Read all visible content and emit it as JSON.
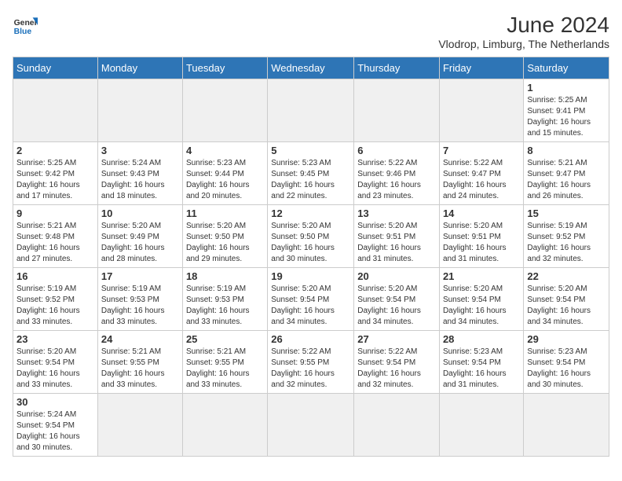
{
  "header": {
    "logo_text_general": "General",
    "logo_text_blue": "Blue",
    "title": "June 2024",
    "subtitle": "Vlodrop, Limburg, The Netherlands"
  },
  "weekdays": [
    "Sunday",
    "Monday",
    "Tuesday",
    "Wednesday",
    "Thursday",
    "Friday",
    "Saturday"
  ],
  "weeks": [
    [
      {
        "day": "",
        "info": "",
        "empty": true
      },
      {
        "day": "",
        "info": "",
        "empty": true
      },
      {
        "day": "",
        "info": "",
        "empty": true
      },
      {
        "day": "",
        "info": "",
        "empty": true
      },
      {
        "day": "",
        "info": "",
        "empty": true
      },
      {
        "day": "",
        "info": "",
        "empty": true
      },
      {
        "day": "1",
        "info": "Sunrise: 5:25 AM\nSunset: 9:41 PM\nDaylight: 16 hours\nand 15 minutes.",
        "empty": false
      }
    ],
    [
      {
        "day": "2",
        "info": "Sunrise: 5:25 AM\nSunset: 9:42 PM\nDaylight: 16 hours\nand 17 minutes.",
        "empty": false
      },
      {
        "day": "3",
        "info": "Sunrise: 5:24 AM\nSunset: 9:43 PM\nDaylight: 16 hours\nand 18 minutes.",
        "empty": false
      },
      {
        "day": "4",
        "info": "Sunrise: 5:23 AM\nSunset: 9:44 PM\nDaylight: 16 hours\nand 20 minutes.",
        "empty": false
      },
      {
        "day": "5",
        "info": "Sunrise: 5:23 AM\nSunset: 9:45 PM\nDaylight: 16 hours\nand 22 minutes.",
        "empty": false
      },
      {
        "day": "6",
        "info": "Sunrise: 5:22 AM\nSunset: 9:46 PM\nDaylight: 16 hours\nand 23 minutes.",
        "empty": false
      },
      {
        "day": "7",
        "info": "Sunrise: 5:22 AM\nSunset: 9:47 PM\nDaylight: 16 hours\nand 24 minutes.",
        "empty": false
      },
      {
        "day": "8",
        "info": "Sunrise: 5:21 AM\nSunset: 9:47 PM\nDaylight: 16 hours\nand 26 minutes.",
        "empty": false
      }
    ],
    [
      {
        "day": "9",
        "info": "Sunrise: 5:21 AM\nSunset: 9:48 PM\nDaylight: 16 hours\nand 27 minutes.",
        "empty": false
      },
      {
        "day": "10",
        "info": "Sunrise: 5:20 AM\nSunset: 9:49 PM\nDaylight: 16 hours\nand 28 minutes.",
        "empty": false
      },
      {
        "day": "11",
        "info": "Sunrise: 5:20 AM\nSunset: 9:50 PM\nDaylight: 16 hours\nand 29 minutes.",
        "empty": false
      },
      {
        "day": "12",
        "info": "Sunrise: 5:20 AM\nSunset: 9:50 PM\nDaylight: 16 hours\nand 30 minutes.",
        "empty": false
      },
      {
        "day": "13",
        "info": "Sunrise: 5:20 AM\nSunset: 9:51 PM\nDaylight: 16 hours\nand 31 minutes.",
        "empty": false
      },
      {
        "day": "14",
        "info": "Sunrise: 5:20 AM\nSunset: 9:51 PM\nDaylight: 16 hours\nand 31 minutes.",
        "empty": false
      },
      {
        "day": "15",
        "info": "Sunrise: 5:19 AM\nSunset: 9:52 PM\nDaylight: 16 hours\nand 32 minutes.",
        "empty": false
      }
    ],
    [
      {
        "day": "16",
        "info": "Sunrise: 5:19 AM\nSunset: 9:52 PM\nDaylight: 16 hours\nand 33 minutes.",
        "empty": false
      },
      {
        "day": "17",
        "info": "Sunrise: 5:19 AM\nSunset: 9:53 PM\nDaylight: 16 hours\nand 33 minutes.",
        "empty": false
      },
      {
        "day": "18",
        "info": "Sunrise: 5:19 AM\nSunset: 9:53 PM\nDaylight: 16 hours\nand 33 minutes.",
        "empty": false
      },
      {
        "day": "19",
        "info": "Sunrise: 5:20 AM\nSunset: 9:54 PM\nDaylight: 16 hours\nand 34 minutes.",
        "empty": false
      },
      {
        "day": "20",
        "info": "Sunrise: 5:20 AM\nSunset: 9:54 PM\nDaylight: 16 hours\nand 34 minutes.",
        "empty": false
      },
      {
        "day": "21",
        "info": "Sunrise: 5:20 AM\nSunset: 9:54 PM\nDaylight: 16 hours\nand 34 minutes.",
        "empty": false
      },
      {
        "day": "22",
        "info": "Sunrise: 5:20 AM\nSunset: 9:54 PM\nDaylight: 16 hours\nand 34 minutes.",
        "empty": false
      }
    ],
    [
      {
        "day": "23",
        "info": "Sunrise: 5:20 AM\nSunset: 9:54 PM\nDaylight: 16 hours\nand 33 minutes.",
        "empty": false
      },
      {
        "day": "24",
        "info": "Sunrise: 5:21 AM\nSunset: 9:55 PM\nDaylight: 16 hours\nand 33 minutes.",
        "empty": false
      },
      {
        "day": "25",
        "info": "Sunrise: 5:21 AM\nSunset: 9:55 PM\nDaylight: 16 hours\nand 33 minutes.",
        "empty": false
      },
      {
        "day": "26",
        "info": "Sunrise: 5:22 AM\nSunset: 9:55 PM\nDaylight: 16 hours\nand 32 minutes.",
        "empty": false
      },
      {
        "day": "27",
        "info": "Sunrise: 5:22 AM\nSunset: 9:54 PM\nDaylight: 16 hours\nand 32 minutes.",
        "empty": false
      },
      {
        "day": "28",
        "info": "Sunrise: 5:23 AM\nSunset: 9:54 PM\nDaylight: 16 hours\nand 31 minutes.",
        "empty": false
      },
      {
        "day": "29",
        "info": "Sunrise: 5:23 AM\nSunset: 9:54 PM\nDaylight: 16 hours\nand 30 minutes.",
        "empty": false
      }
    ],
    [
      {
        "day": "30",
        "info": "Sunrise: 5:24 AM\nSunset: 9:54 PM\nDaylight: 16 hours\nand 30 minutes.",
        "empty": false
      },
      {
        "day": "",
        "info": "",
        "empty": true
      },
      {
        "day": "",
        "info": "",
        "empty": true
      },
      {
        "day": "",
        "info": "",
        "empty": true
      },
      {
        "day": "",
        "info": "",
        "empty": true
      },
      {
        "day": "",
        "info": "",
        "empty": true
      },
      {
        "day": "",
        "info": "",
        "empty": true
      }
    ]
  ]
}
